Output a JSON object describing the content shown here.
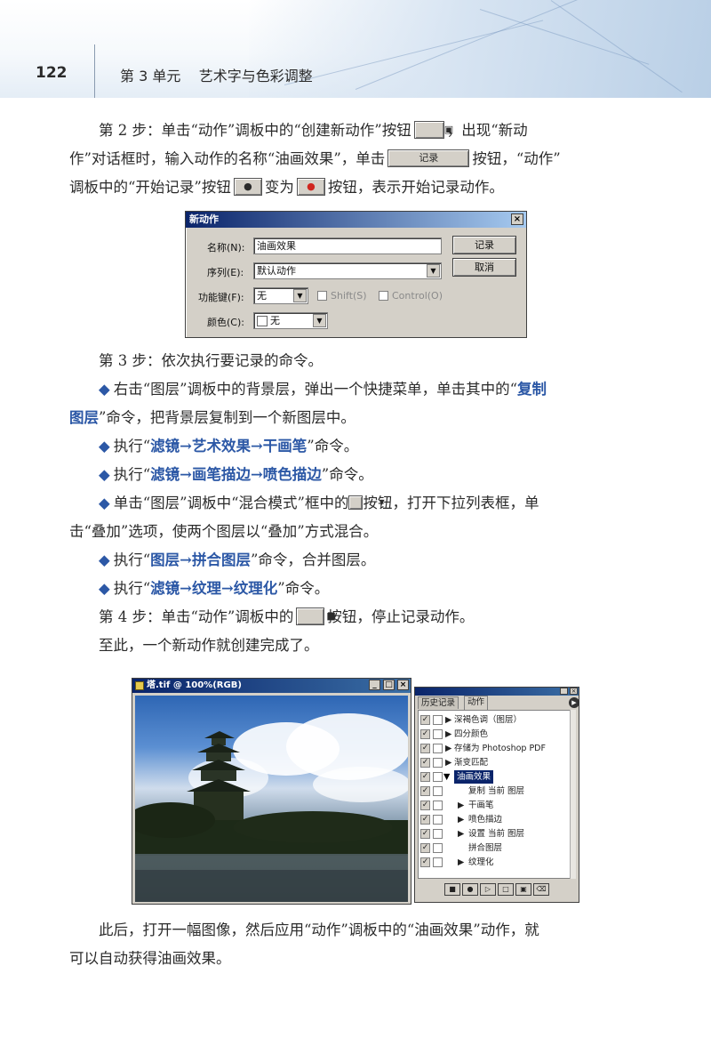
{
  "header": {
    "page_number": "122",
    "chapter": "第 3 单元    艺术字与色彩调整"
  },
  "step2": {
    "line1a": "第 2 步：单击“动作”调板中的“创建新动作”按钮",
    "line1b": "，出现“新动",
    "line2a": "作”对话框时，输入动作的名称“油画效果”，单击",
    "record_button": "记录",
    "line2b": "按钮，“动作”",
    "line3a": "调板中的“开始记录”按钮",
    "line3b": "变为",
    "line3c": "按钮，表示开始记录动作。"
  },
  "dialog": {
    "title": "新动作",
    "close": "×",
    "name_label": "名称(N):",
    "name_value": "油画效果",
    "set_label": "序列(E):",
    "set_value": "默认动作",
    "fkey_label": "功能键(F):",
    "fkey_value": "无",
    "shift_label": "Shift(S)",
    "control_label": "Control(O)",
    "color_label": "颜色(C):",
    "color_value": "无",
    "record_btn": "记录",
    "cancel_btn": "取消"
  },
  "step3": "第 3 步：依次执行要记录的命令。",
  "bullets": {
    "b1_pre": "右击“图层”调板中的背景层，弹出一个快捷菜单，单击其中的“",
    "b1_blue": "复制",
    "b1_blue2": "图层",
    "b1_post": "”命令，把背景层复制到一个新图层中。",
    "b2_pre": "执行“",
    "b2_blue": "滤镜→艺术效果→干画笔",
    "b2_post": "”命令。",
    "b3_pre": "执行“",
    "b3_blue": "滤镜→画笔描边→喷色描边",
    "b3_post": "”命令。",
    "b4_line1a": "单击“图层”调板中“混合模式”框中的",
    "b4_line1b": "按钮，打开下拉列表框，单",
    "b4_line2": "击“叠加”选项，使两个图层以“叠加”方式混合。",
    "b5_pre": "执行“",
    "b5_blue": "图层→拼合图层",
    "b5_post": "”命令，合并图层。",
    "b6_pre": "执行“",
    "b6_blue": "滤镜→纹理→纹理化",
    "b6_post": "”命令。",
    "symbol": "◆"
  },
  "step4a": "第 4 步：单击“动作”调板中的",
  "step4b": "按钮，停止记录动作。",
  "done": "至此，一个新动作就创建完成了。",
  "image_window": {
    "title": "塔.tif @ 100%(RGB)"
  },
  "actions_panel": {
    "tab_history": "历史记录",
    "tab_actions": "动作",
    "rows": [
      "深褐色调（图层）",
      "四分颜色",
      "存储为 Photoshop PDF",
      "渐变匹配",
      "油画效果",
      "复制 当前 图层",
      "干画笔",
      "喷色描边",
      "设置 当前 图层",
      "拼合图层",
      "纹理化"
    ]
  },
  "closing_line1": "此后，打开一幅图像，然后应用“动作”调板中的“油画效果”动作，就",
  "closing_line2": "可以自动获得油画效果。"
}
